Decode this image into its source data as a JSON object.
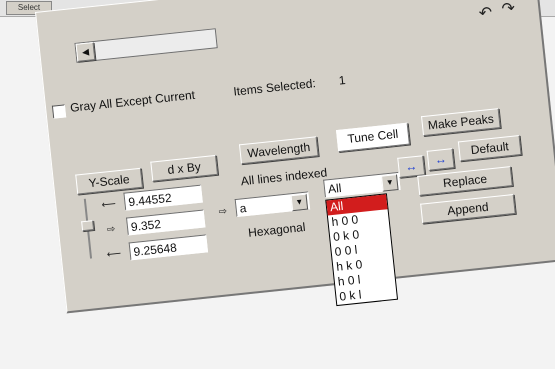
{
  "top_strip": {
    "button_label": "Select",
    "text": ""
  },
  "controls": {
    "grey_all_except_current": {
      "label": "Gray All Except Current",
      "checked": false
    },
    "items_selected_label": "Items Selected:",
    "items_selected_value": "1",
    "y_scale_label": "Y-Scale",
    "dxby_label": "d x By",
    "wavelength_label": "Wavelength",
    "tune_cell_label": "Tune Cell",
    "make_peaks_label": "Make Peaks",
    "default_label": "Default",
    "replace_label": "Replace",
    "append_label": "Append",
    "all_lines_indexed": "All lines indexed",
    "double_arrow_1": "↔",
    "double_arrow_2": "↔",
    "values": [
      "9.44552",
      "9.352",
      "9.25648"
    ],
    "axis_select_value": "a",
    "lattice_type": "Hexagonal",
    "filter_select_value": "All",
    "filter_options": [
      "All",
      "h 0 0",
      "0 k 0",
      "0 0 l",
      "h k 0",
      "h 0 l",
      "0 k l"
    ],
    "selected_option_index": 0,
    "undo_icon_label": "↶",
    "redo_icon_label": "↷"
  },
  "colors": {
    "panel": "#d4d0c8",
    "selection": "#d21d1d",
    "accent_arrow": "#1f3fd1"
  }
}
